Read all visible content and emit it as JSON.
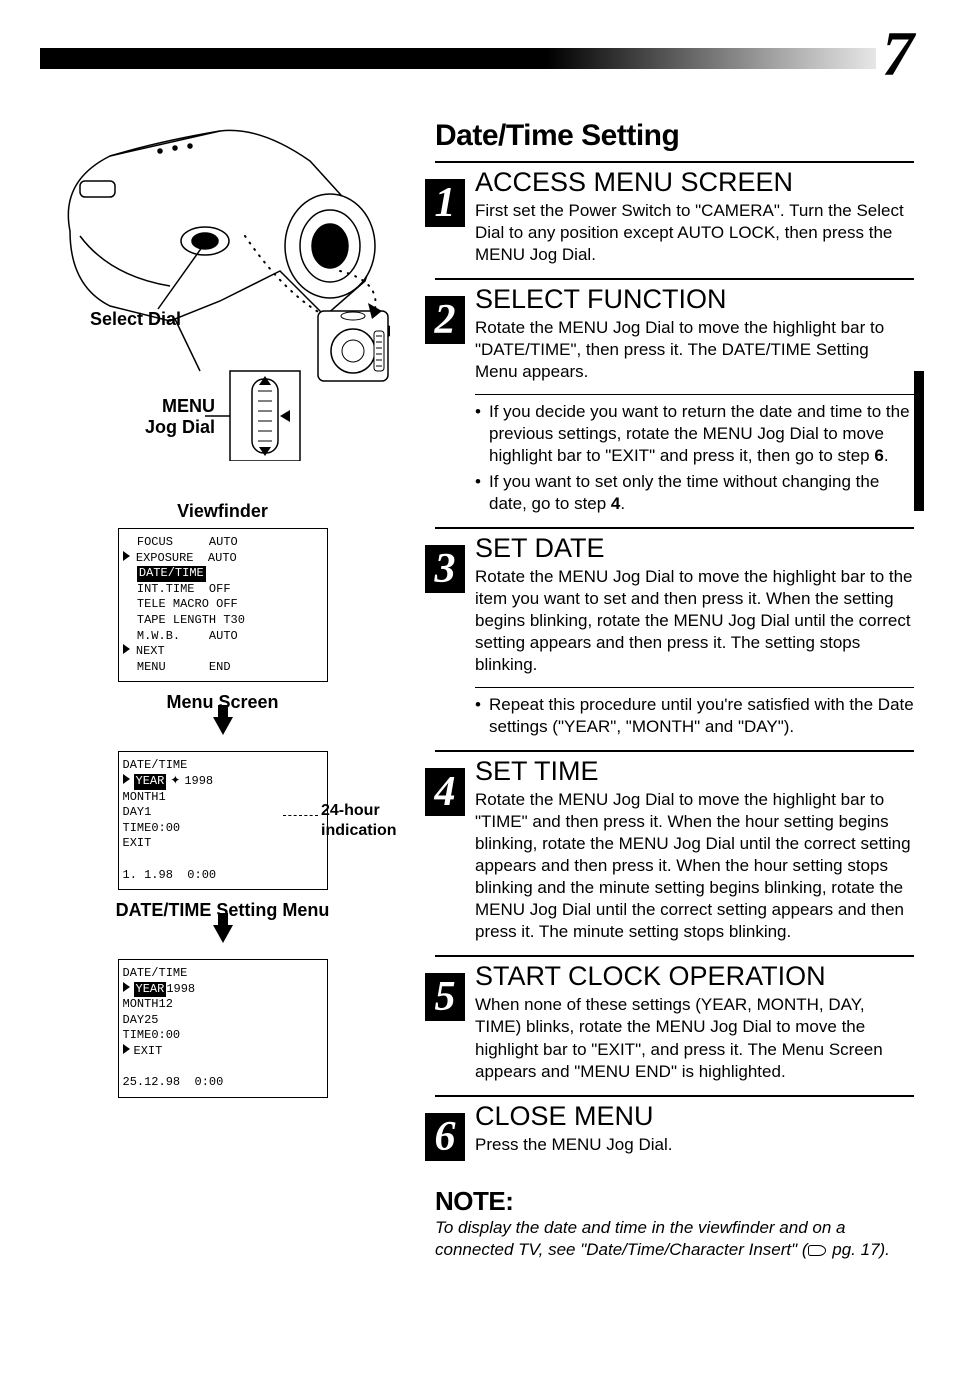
{
  "page_number": "7",
  "camera": {
    "select_dial_label": "Select Dial",
    "menu_jog_label_line1": "MENU",
    "menu_jog_label_line2": "Jog Dial"
  },
  "viewfinder_label": "Viewfinder",
  "menu_screen_label": "Menu Screen",
  "datetime_menu_label": "DATE/TIME Setting Menu",
  "hour_note_line1": "24-hour",
  "hour_note_line2": "indication",
  "viewfinder_screen": {
    "l1": "  FOCUS     AUTO",
    "l2": "  EXPOSURE  AUTO",
    "l3_hl": "DATE/TIME",
    "l4": "  INT.TIME  OFF",
    "l5": "  TELE MACRO OFF",
    "l6": "  TAPE LENGTH T30",
    "l7": "  M.W.B.    AUTO",
    "l8": "  NEXT",
    "l9": "  MENU      END"
  },
  "dt_screen": {
    "title": "DATE/TIME",
    "y_label": "YEAR",
    "y_val": "1998",
    "m_label": "MONTH",
    "m_val": "1",
    "d_label": "DAY",
    "d_val": "1",
    "t_label": "TIME",
    "t_val": "0:00",
    "exit": "EXIT",
    "footer": "1. 1.98  0:00"
  },
  "dt_screen2": {
    "title": "DATE/TIME",
    "y_hl": "YEAR",
    "y_val": "1998",
    "m_label": "MONTH",
    "m_val": "12",
    "d_label": "DAY",
    "d_val": "25",
    "t_label": "TIME",
    "t_val": "0:00",
    "exit": "EXIT",
    "footer": "25.12.98  0:00"
  },
  "section_title": "Date/Time Setting",
  "steps": [
    {
      "num": "1",
      "head": "ACCESS MENU SCREEN",
      "body": "First set the Power Switch to \"CAMERA\". Turn the Select Dial to any position except AUTO LOCK, then press the MENU Jog Dial."
    },
    {
      "num": "2",
      "head": "SELECT FUNCTION",
      "body": "Rotate the MENU Jog Dial to move the highlight bar to \"DATE/TIME\", then press it. The DATE/TIME Setting Menu appears.",
      "bullets": [
        "If you decide you want to return the date and time to the previous settings, rotate the MENU Jog Dial to move highlight bar to \"EXIT\" and press it, then go to step 6.",
        "If you want to set only the time without changing the date, go to step 4."
      ],
      "bold_a": "6",
      "bold_b": "4"
    },
    {
      "num": "3",
      "head": "SET DATE",
      "body": "Rotate the MENU Jog Dial to move the highlight bar to the item you want to set and then press it. When the setting begins blinking, rotate the MENU Jog Dial until the correct setting appears and then press it. The setting stops blinking.",
      "bullets": [
        "Repeat this procedure until you're satisfied with the Date settings (\"YEAR\", \"MONTH\" and \"DAY\")."
      ]
    },
    {
      "num": "4",
      "head": "SET TIME",
      "body": "Rotate the MENU Jog Dial to move the highlight bar to \"TIME\" and then press it. When the hour setting begins blinking, rotate the MENU Jog Dial until the correct setting appears and then press it. When the hour setting stops blinking and the minute setting begins blinking, rotate the MENU Jog Dial until the correct setting appears and then press it. The minute setting stops blinking."
    },
    {
      "num": "5",
      "head": "START CLOCK OPERATION",
      "body": "When none of these settings (YEAR, MONTH, DAY, TIME) blinks, rotate the MENU Jog Dial to move the highlight bar to \"EXIT\", and press it. The Menu Screen appears and \"MENU END\" is highlighted."
    },
    {
      "num": "6",
      "head": "CLOSE MENU",
      "body": "Press the MENU Jog Dial."
    }
  ],
  "note": {
    "head": "NOTE:",
    "body_a": "To display the date and time in the viewfinder and on a connected TV, see \"Date/Time/Character Insert\" (",
    "body_b": " pg. 17)."
  }
}
